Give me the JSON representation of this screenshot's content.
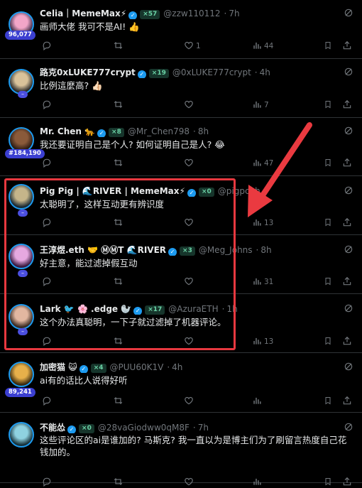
{
  "tweets": [
    {
      "name": "Celia｜MemeMax⚡",
      "level": "57",
      "handle": "@zzw110112",
      "time": "7h",
      "text": "画师大佬 我可不是AI! 👍",
      "badge": "96,077",
      "replies": "",
      "retweets": "",
      "likes": "1",
      "views": "44"
    },
    {
      "name": "路克0xLUKE777crypt",
      "level": "19",
      "handle": "@0xLUKE777crypt",
      "time": "4h",
      "text": "比例這麼高? 👍🏻",
      "badge": "",
      "replies": "",
      "retweets": "",
      "likes": "",
      "views": "7"
    },
    {
      "name": "Mr. Chen 🐆",
      "level": "8",
      "handle": "@Mr_Chen798",
      "time": "8h",
      "text": "我还要证明自己是个人? 如何证明自己是人? 😂",
      "badge": "#184,190",
      "replies": "",
      "retweets": "",
      "likes": "",
      "views": "47"
    },
    {
      "name": "Pig Pig | 🌊RIVER | MemeMax⚡",
      "level": "0",
      "handle": "@pigpchh",
      "time": "",
      "text": "太聪明了，这样互动更有辨识度",
      "badge": "",
      "replies": "",
      "retweets": "",
      "likes": "",
      "views": "13"
    },
    {
      "name": "王淳煜.eth 🤝 ⓂⓂT 🌊RIVER",
      "level": "3",
      "handle": "@Meg_Johns",
      "time": "8h",
      "text": "好主意，能过滤掉假互动",
      "badge": "",
      "replies": "",
      "retweets": "",
      "likes": "",
      "views": "31"
    },
    {
      "name": "Lark 🐦 🌸 .edge 🦭",
      "level": "17",
      "handle": "@AzuraETH",
      "time": "1h",
      "text": "这个办法真聪明，一下子就过滤掉了机器评论。",
      "badge": "",
      "replies": "",
      "retweets": "",
      "likes": "",
      "views": "13"
    },
    {
      "name": "加密猫 😺",
      "level": "4",
      "handle": "@PUU60K1V",
      "time": "4h",
      "text": "ai有的话比人说得好听",
      "badge": "89,241",
      "replies": "",
      "retweets": "",
      "likes": "",
      "views": ""
    },
    {
      "name": "不能怂",
      "level": "0",
      "handle": "@28vaGiodww0qM8F",
      "time": "7h",
      "text": "这些评论区的ai是谁加的? 马斯克? 我一直以为是博主们为了刷留言热度自己花钱加的。",
      "badge": "",
      "replies": "",
      "retweets": "",
      "likes": "",
      "views": ""
    }
  ],
  "sep": "·",
  "dash": "–",
  "level_prefix": "×",
  "colors": {
    "accent": "#1d9bf0",
    "highlight": "#e7383f",
    "level_bg": "#16352b",
    "level_fg": "#6bd3a6",
    "muted": "#71767b"
  },
  "icons": {
    "reply": "reply-icon",
    "retweet": "retweet-icon",
    "like": "heart-icon",
    "views": "views-icon",
    "bookmark": "bookmark-icon",
    "share": "share-icon",
    "grok": "grok-icon",
    "more": "more-icon"
  }
}
